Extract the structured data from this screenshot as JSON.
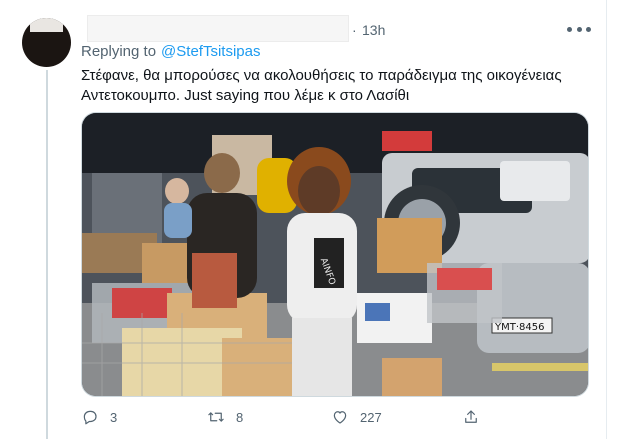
{
  "tweet": {
    "time": "13h",
    "dot": "·",
    "replying_prefix": "Replying to",
    "replying_handle": "@StefTsitsipas",
    "text": "Στέφανε, θα μπορούσες να ακολουθήσεις το παράδειγμα της οικογένειας Αντετοκουμπο. Just saying που λέμε κ στο Λασίθι",
    "media": {
      "plate": "ΥΜΤ·8456",
      "sign": "AINFO"
    },
    "actions": {
      "reply_count": "3",
      "retweet_count": "8",
      "like_count": "227"
    }
  },
  "colors": {
    "accent": "#1d9bf0",
    "secondary_text": "#536471",
    "primary_text": "#0f1419"
  },
  "icons": [
    "more-icon",
    "reply-icon",
    "retweet-icon",
    "like-icon",
    "share-icon"
  ]
}
